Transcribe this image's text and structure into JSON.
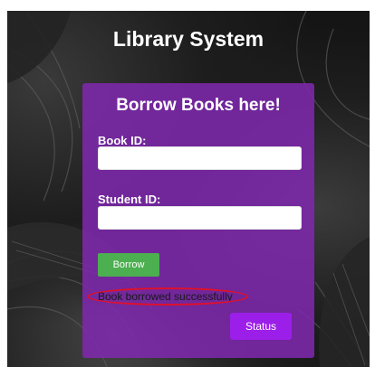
{
  "page": {
    "title": "Library System"
  },
  "form": {
    "heading": "Borrow Books here!",
    "book_id_label": "Book ID:",
    "book_id_value": "",
    "student_id_label": "Student ID:",
    "student_id_value": "",
    "borrow_label": "Borrow",
    "message": "Book borrowed successfully",
    "status_label": "Status"
  },
  "colors": {
    "card": "#8028b0",
    "borrow_button": "#4caf50",
    "status_button": "#9b1fe8",
    "annotation": "#e0102a"
  }
}
